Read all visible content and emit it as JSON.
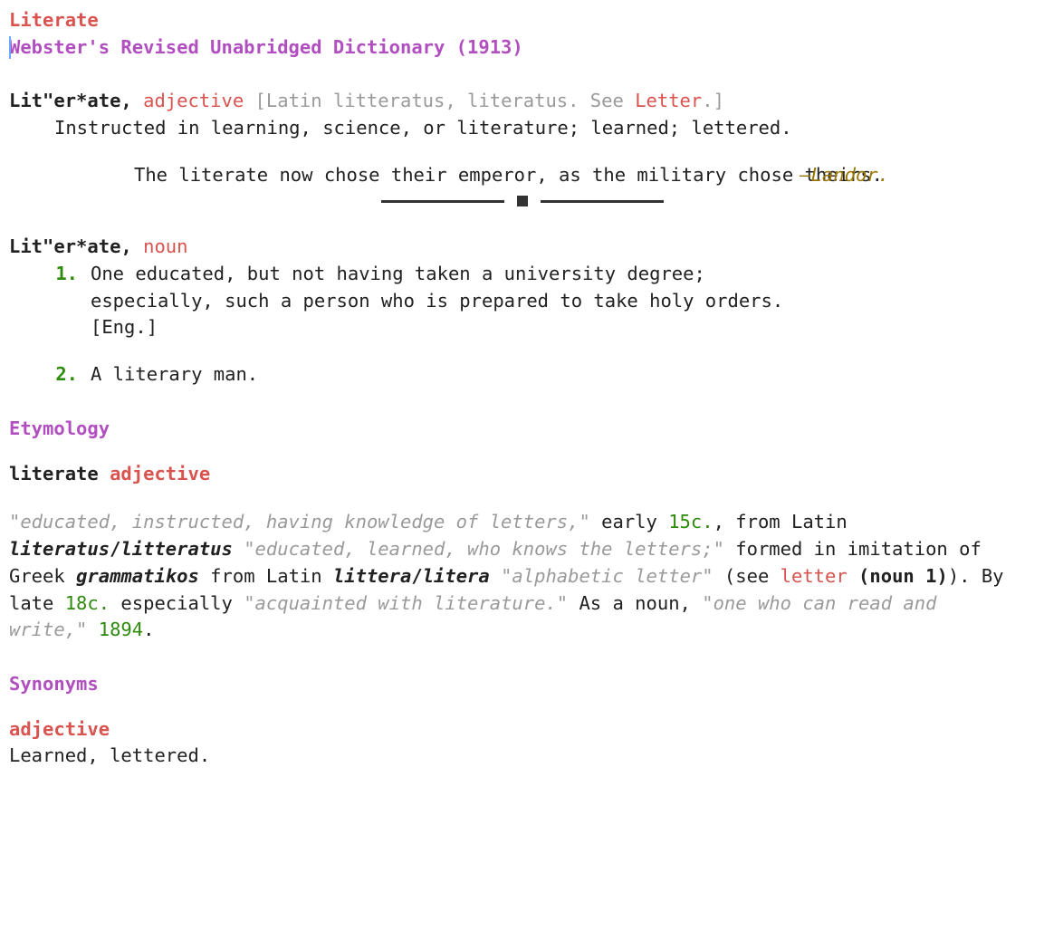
{
  "headword": "Literate",
  "subtitle": "Webster's Revised Unabridged Dictionary (1913)",
  "adj": {
    "headword_marked": "Lit\"er*ate",
    "comma": ", ",
    "pos": "adjective",
    "sp": " ",
    "bracket_open": "[",
    "etym": "Latin litteratus, literatus. See ",
    "letter_link": "Letter",
    "dot_bracket": ".]",
    "definition": "Instructed in learning, science, or literature; learned; lettered.",
    "quote": "The literate now chose their emperor, as the military chose theirs.",
    "attr_dash": "—",
    "attr_name": "Landor."
  },
  "noun": {
    "headword_marked": "Lit\"er*ate",
    "comma": ", ",
    "pos": "noun",
    "senses": [
      {
        "num": "1.",
        "text": "One educated, but not having taken a university degree; especially, such a person who is prepared to take holy orders. [Eng.]"
      },
      {
        "num": "2.",
        "text": "A literary man."
      }
    ]
  },
  "sections": {
    "etymology": "Etymology",
    "synonyms": "Synonyms"
  },
  "ety": {
    "word": "literate",
    "sp": " ",
    "pos": "adjective",
    "quote1": "\"educated, instructed, having knowledge of letters,\"",
    "t1": " early ",
    "date1": "15c.",
    "t2": ", from Latin ",
    "lat1": "literatus",
    "slash1": "/",
    "lat2": "litteratus",
    "sp2": " ",
    "quote2": "\"educated, learned, who knows the letters;\"",
    "t3": " formed in imitation of Greek ",
    "greek": "grammatikos",
    "t4": " from Latin ",
    "lat3": "littera",
    "slash2": "/",
    "lat4": "litera",
    "sp3": " ",
    "quote3": "\"alphabetic letter\"",
    "t5": " (see ",
    "letter_link": "letter",
    "t6": " (noun 1)",
    "t7": "). By late ",
    "date2": "18c.",
    "t8": " especially ",
    "quote4": "\"acquainted with literature.\"",
    "t9": " As a noun, ",
    "quote5": "\"one who can read and write,\"",
    "sp4": " ",
    "date3": "1894",
    "t10": "."
  },
  "syn": {
    "pos": "adjective",
    "text": "Learned, lettered."
  }
}
